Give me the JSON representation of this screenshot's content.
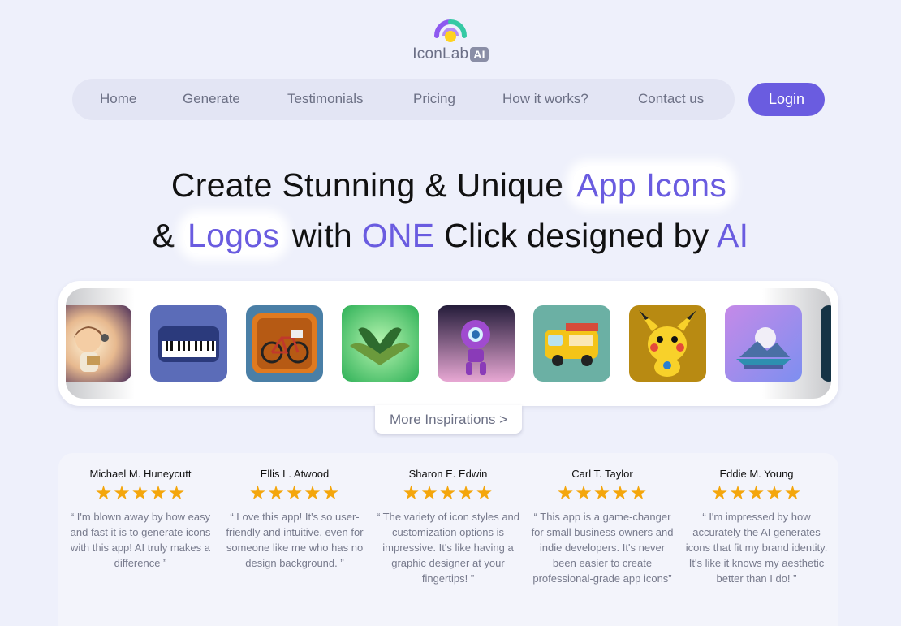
{
  "brand": {
    "name": "IconLab",
    "badge": "AI",
    "colors": {
      "accent": "#6a5ce0",
      "arc_left": "#8e59f0",
      "arc_right": "#35c9a4",
      "dot": "#ffd21f"
    }
  },
  "nav": {
    "items": [
      {
        "label": "Home"
      },
      {
        "label": "Generate"
      },
      {
        "label": "Testimonials"
      },
      {
        "label": "Pricing"
      },
      {
        "label": "How it works?"
      },
      {
        "label": "Contact us"
      }
    ],
    "login_label": "Login"
  },
  "hero": {
    "line1": {
      "a": "Create Stunning & Unique ",
      "b": "App Icons"
    },
    "line2": {
      "a": "& ",
      "b": "Logos",
      "c": " with ",
      "d": "ONE",
      "e": " Click designed by ",
      "f": "AI"
    }
  },
  "gallery": {
    "icons": [
      {
        "name": "girl-character-icon"
      },
      {
        "name": "piano-keyboard-icon"
      },
      {
        "name": "bicycle-icon"
      },
      {
        "name": "open-book-icon"
      },
      {
        "name": "robot-icon"
      },
      {
        "name": "food-truck-icon"
      },
      {
        "name": "pikachu-icon"
      },
      {
        "name": "floating-island-icon"
      },
      {
        "name": "dark-partial-icon"
      }
    ],
    "more_label": "More Inspirations >"
  },
  "testimonials": [
    {
      "name": "Michael M. Huneycutt",
      "stars": "★★★★★",
      "rating": 5,
      "quote": "“ I'm blown away by how easy and fast it is to generate icons with this app! AI truly makes a difference ”"
    },
    {
      "name": "Ellis L. Atwood",
      "stars": "★★★★★",
      "rating": 5,
      "quote": "“ Love this app! It's so user-friendly and intuitive, even for someone like me who has no design background. ”"
    },
    {
      "name": "Sharon E. Edwin",
      "stars": "★★★★★",
      "rating": 5,
      "quote": "“ The variety of icon styles and customization options is impressive. It's like having a graphic designer at your fingertips! ”"
    },
    {
      "name": "Carl T. Taylor",
      "stars": "★★★★★",
      "rating": 5,
      "quote": "“ This app is a game-changer for small business owners and indie developers. It's never been easier to create professional-grade app icons”"
    },
    {
      "name": "Eddie M. Young",
      "stars": "★★★★★",
      "rating": 5,
      "quote": "“ I'm impressed by how accurately the AI generates icons that fit my brand identity. It's like it knows my aesthetic better than I do! ”"
    }
  ]
}
